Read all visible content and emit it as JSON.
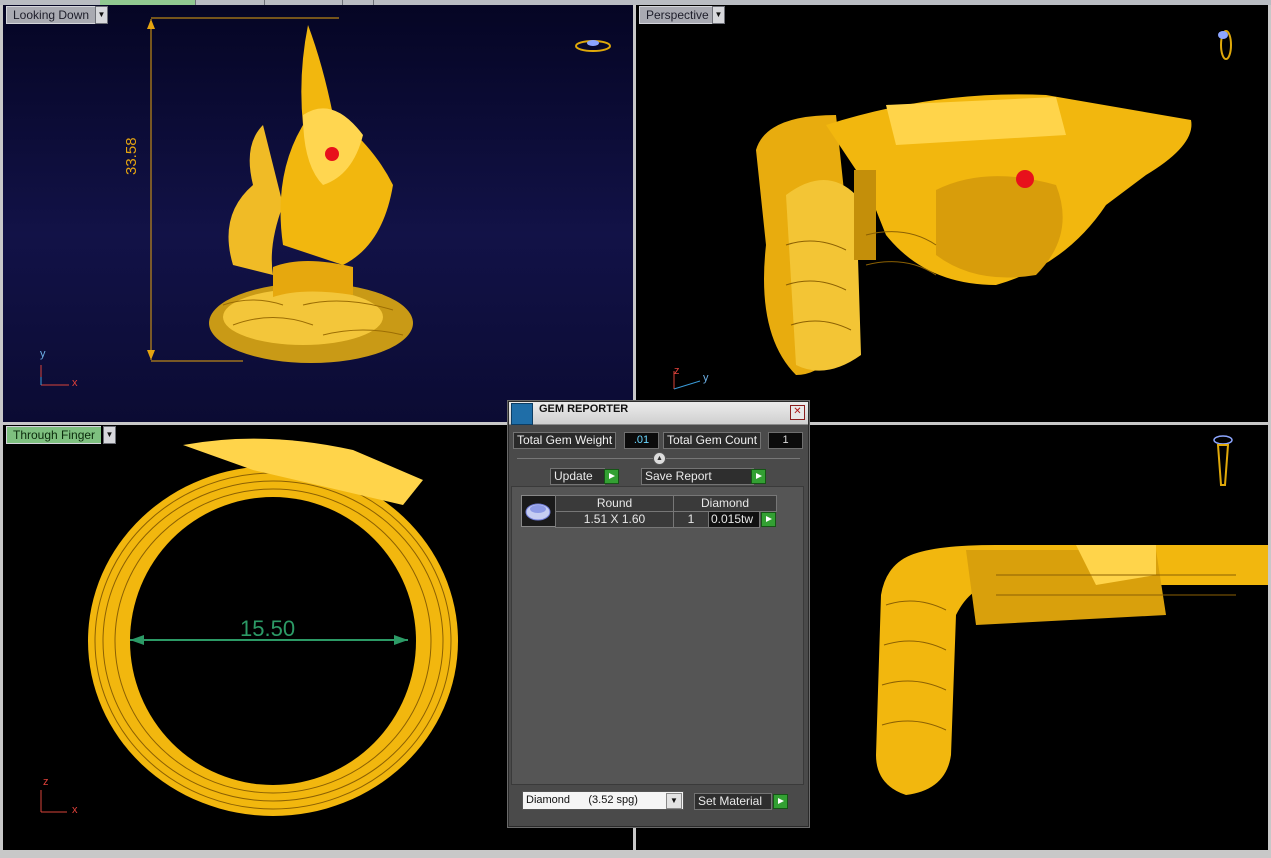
{
  "viewports": {
    "top_left": {
      "label": "Looking Down",
      "dimension": "33.58",
      "axis": {
        "vertical": "y",
        "horizontal": "x"
      }
    },
    "top_right": {
      "label": "Perspective",
      "axis": {
        "vertical": "z",
        "horizontal": "y"
      }
    },
    "bottom_left": {
      "label": "Through Finger",
      "dimension": "15.50",
      "axis": {
        "vertical": "z",
        "horizontal": "x"
      }
    },
    "bottom_right": {
      "label": ""
    }
  },
  "gem_reporter": {
    "title": "GEM REPORTER",
    "close_glyph": "✕",
    "total_weight_label": "Total Gem Weight",
    "total_weight_value": ".01",
    "total_count_label": "Total Gem Count",
    "total_count_value": "1",
    "update_label": "Update",
    "save_report_label": "Save Report",
    "headers": {
      "shape": "Round",
      "material": "Diamond"
    },
    "rows": [
      {
        "size": "1.51 X 1.60",
        "count": "1",
        "weight": "0.015tw"
      }
    ],
    "material_option": "Diamond      (3.52 spg)",
    "set_material_label": "Set Material"
  },
  "colors": {
    "gold": "#f2b70e",
    "dim_line": "#e5a410",
    "dim_green": "#2c9a66",
    "gem_red": "#e8101b"
  }
}
